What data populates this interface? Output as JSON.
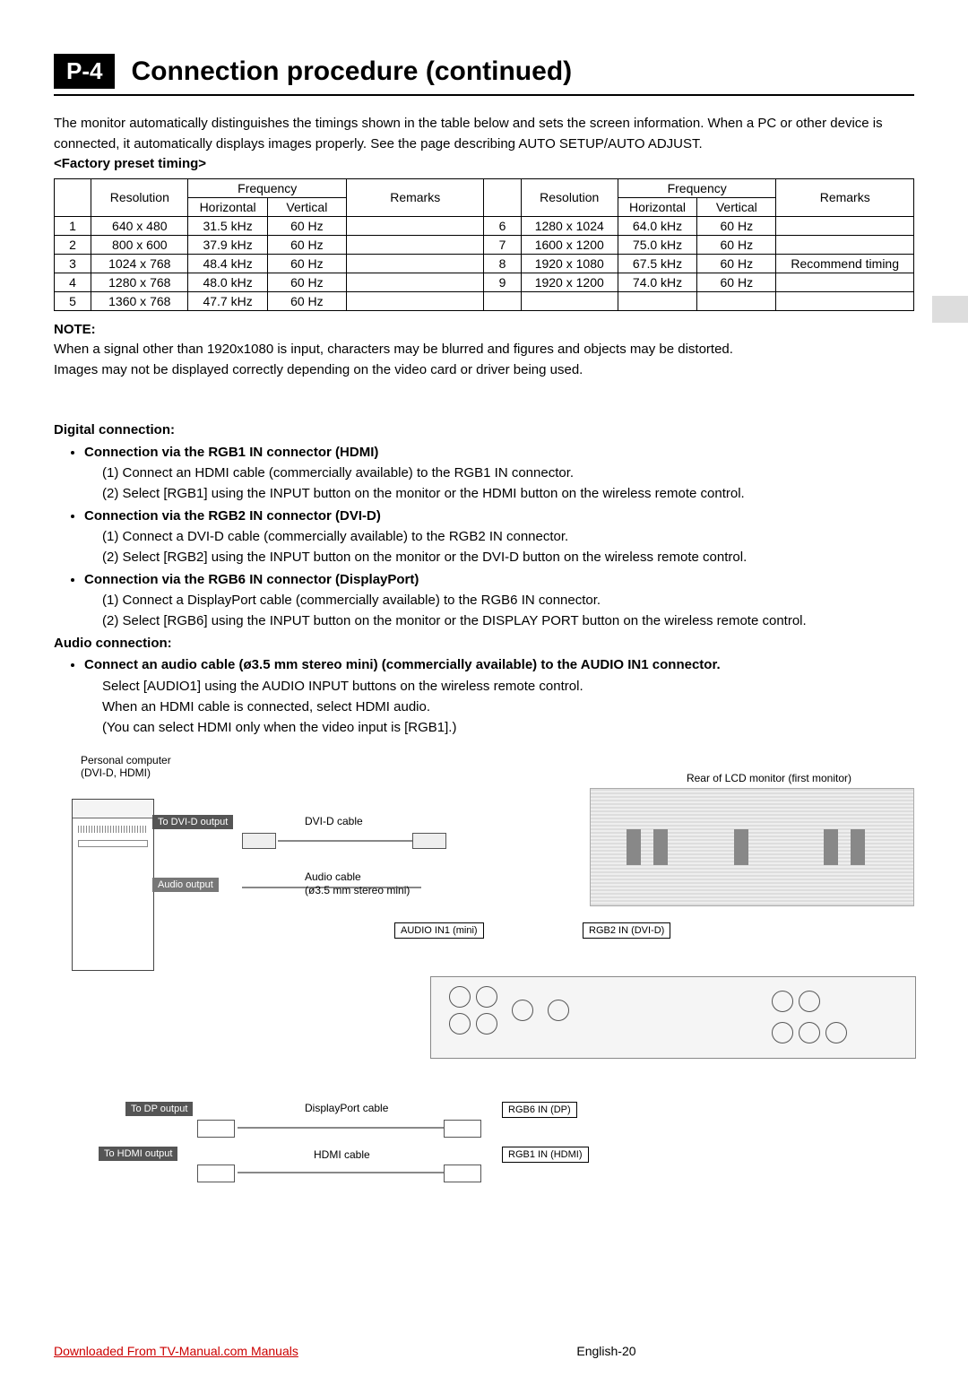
{
  "header": {
    "badge": "P-4",
    "title": "Connection procedure (continued)"
  },
  "intro": "The monitor automatically distinguishes the timings shown in the table below and sets the screen information. When a PC or other device is connected, it automatically displays images properly. See the page describing AUTO SETUP/AUTO ADJUST.",
  "preset_label": "<Factory preset timing>",
  "table_headers": {
    "resolution": "Resolution",
    "frequency": "Frequency",
    "horizontal": "Horizontal",
    "vertical": "Vertical",
    "remarks": "Remarks"
  },
  "chart_data": {
    "type": "table",
    "title": "Factory preset timing",
    "columns": [
      "#",
      "Resolution",
      "Horizontal",
      "Vertical",
      "Remarks"
    ],
    "rows_left": [
      {
        "idx": "1",
        "res": "640 x 480",
        "h": "31.5 kHz",
        "v": "60 Hz",
        "r": ""
      },
      {
        "idx": "2",
        "res": "800 x 600",
        "h": "37.9 kHz",
        "v": "60 Hz",
        "r": ""
      },
      {
        "idx": "3",
        "res": "1024 x 768",
        "h": "48.4 kHz",
        "v": "60 Hz",
        "r": ""
      },
      {
        "idx": "4",
        "res": "1280 x 768",
        "h": "48.0 kHz",
        "v": "60 Hz",
        "r": ""
      },
      {
        "idx": "5",
        "res": "1360 x 768",
        "h": "47.7 kHz",
        "v": "60 Hz",
        "r": ""
      }
    ],
    "rows_right": [
      {
        "idx": "6",
        "res": "1280 x 1024",
        "h": "64.0 kHz",
        "v": "60 Hz",
        "r": ""
      },
      {
        "idx": "7",
        "res": "1600 x 1200",
        "h": "75.0 kHz",
        "v": "60 Hz",
        "r": ""
      },
      {
        "idx": "8",
        "res": "1920 x 1080",
        "h": "67.5 kHz",
        "v": "60 Hz",
        "r": "Recommend timing"
      },
      {
        "idx": "9",
        "res": "1920 x 1200",
        "h": "74.0 kHz",
        "v": "60 Hz",
        "r": ""
      }
    ]
  },
  "note_label": "NOTE:",
  "note_lines": [
    "When a signal other than 1920x1080 is input, characters may be blurred and figures and objects may be distorted.",
    "Images may not be displayed correctly depending on the video card or driver being used."
  ],
  "digital": {
    "heading": "Digital connection:",
    "items": [
      {
        "title": "Connection via the RGB1 IN connector (HDMI)",
        "steps": [
          "(1) Connect an HDMI cable (commercially available) to the RGB1 IN connector.",
          "(2) Select [RGB1] using the INPUT button on the monitor or the HDMI button on the wireless remote control."
        ]
      },
      {
        "title": "Connection via the RGB2 IN connector (DVI-D)",
        "steps": [
          "(1) Connect a DVI-D cable (commercially available) to the RGB2 IN connector.",
          "(2) Select [RGB2] using the INPUT button on the monitor or the DVI-D button on the wireless remote control."
        ]
      },
      {
        "title": "Connection via the RGB6 IN connector (DisplayPort)",
        "steps": [
          "(1) Connect a DisplayPort cable (commercially available) to the RGB6 IN connector.",
          "(2) Select [RGB6] using the INPUT button on the monitor or the DISPLAY PORT button on the wireless remote control."
        ]
      }
    ]
  },
  "audio": {
    "heading": "Audio connection:",
    "title": "Connect an audio cable (ø3.5 mm stereo mini) (commercially available) to the AUDIO IN1 connector.",
    "lines": [
      "Select [AUDIO1] using the AUDIO INPUT buttons on the wireless remote control.",
      "When an HDMI cable is connected, select HDMI audio.",
      "(You can select HDMI only when the video input is [RGB1].)"
    ]
  },
  "diagram": {
    "pc_label1": "Personal computer",
    "pc_label2": "(DVI-D, HDMI)",
    "rear_label": "Rear of LCD monitor (first monitor)",
    "to_dvid": "To DVI-D output",
    "audio_out": "Audio output",
    "to_dp": "To DP output",
    "to_hdmi": "To HDMI output",
    "dvid_cable": "DVI-D cable",
    "audio_cable": "Audio cable",
    "audio_cable2": "(ø3.5 mm stereo mini)",
    "dp_cable": "DisplayPort cable",
    "hdmi_cable": "HDMI cable",
    "audio_in1": "AUDIO IN1 (mini)",
    "rgb2_in": "RGB2 IN (DVI-D)",
    "rgb6_in": "RGB6 IN (DP)",
    "rgb1_in": "RGB1 IN (HDMI)"
  },
  "footer": {
    "download": "Downloaded From TV-Manual.com Manuals",
    "page": "English-20"
  }
}
